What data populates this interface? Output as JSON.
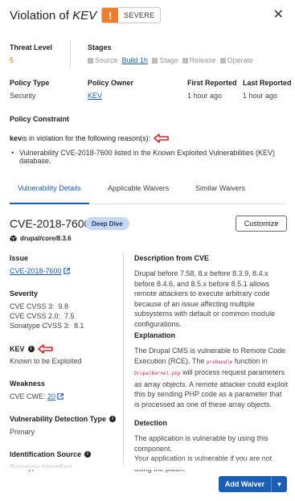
{
  "header": {
    "title_prefix": "Violation of ",
    "title_name": "KEV",
    "severity_icon": "!",
    "severity_label": "SEVERE",
    "close_glyph": "✕",
    "accent": "#f07d2b"
  },
  "summary": {
    "threat_level_label": "Threat Level",
    "threat_level_value": "5",
    "stages_label": "Stages",
    "stages": [
      {
        "label": "Source",
        "link": false
      },
      {
        "label": "Build 1h",
        "link": true
      },
      {
        "label": "Stage",
        "link": false
      },
      {
        "label": "Release",
        "link": false
      },
      {
        "label": "Operate",
        "link": false
      }
    ],
    "policy_type_label": "Policy Type",
    "policy_type_value": "Security",
    "policy_owner_label": "Policy Owner",
    "policy_owner_value": "KEV",
    "first_reported_label": "First Reported",
    "first_reported_value": "1 hour ago",
    "last_reported_label": "Last Reported",
    "last_reported_value": "1 hour ago"
  },
  "constraint": {
    "heading": "Policy Constraint",
    "reason_name": "kev",
    "reason_text": " is in violation for the following reason(s):",
    "reason_item": "Vulnerability CVE-2018-7600 listed in the Known Exploited Vulnerabilities (KEV) database."
  },
  "tabs": [
    "Vulnerability Details",
    "Applicable Waivers",
    "Similar Waivers"
  ],
  "vuln": {
    "cve_id": "CVE-2018-7600",
    "deep_dive": "Deep Dive",
    "customize": "Customize",
    "package": "drupal/core/8.3.6",
    "issue_label": "Issue",
    "issue_link": "CVE-2018-7600",
    "severity_label": "Severity",
    "severity_lines": [
      "CVE CVSS 3:  9.8",
      "CVE CVSS 2.0:  7.5",
      "Sonatype CVSS 3:  8.1"
    ],
    "kev_label": "KEV",
    "kev_value": "Known to be Exploited",
    "weakness_label": "Weakness",
    "cwe_prefix": "CVE CWE: ",
    "cwe_link": "20",
    "detection_type_label": "Vulnerability Detection Type",
    "detection_type_value": "Primary",
    "id_source_label": "Identification Source",
    "id_source_value": "Sonatype Identified",
    "desc_heading": "Description from CVE",
    "desc_text": "Drupal before 7.58, 8.x before 8.3.9, 8.4.x before 8.4.6, and 8.5.x before 8.5.1 allows remote attackers to execute arbitrary code because of an issue affecting multiple subsystems with default or common module configurations.",
    "explanation_heading": "Explanation",
    "explanation_a": "The Drupal CMS is vulnerable to Remote Code Execution (RCE). The ",
    "explanation_code1": "preHandle",
    "explanation_b": " function in ",
    "explanation_code2": "DrupalKernel.php",
    "explanation_c": " will process request parameters as array objects. A remote attacker could exploit this by sending PHP code as a parameter that is processed as one of these array objects.",
    "detection_heading": "Detection",
    "detection_text": "The application is vulnerable by using this component.",
    "detection_text2": "Your application is vulnerable if you are not using the patch."
  },
  "footer": {
    "add_waiver": "Add Waiver",
    "caret": "▼"
  }
}
